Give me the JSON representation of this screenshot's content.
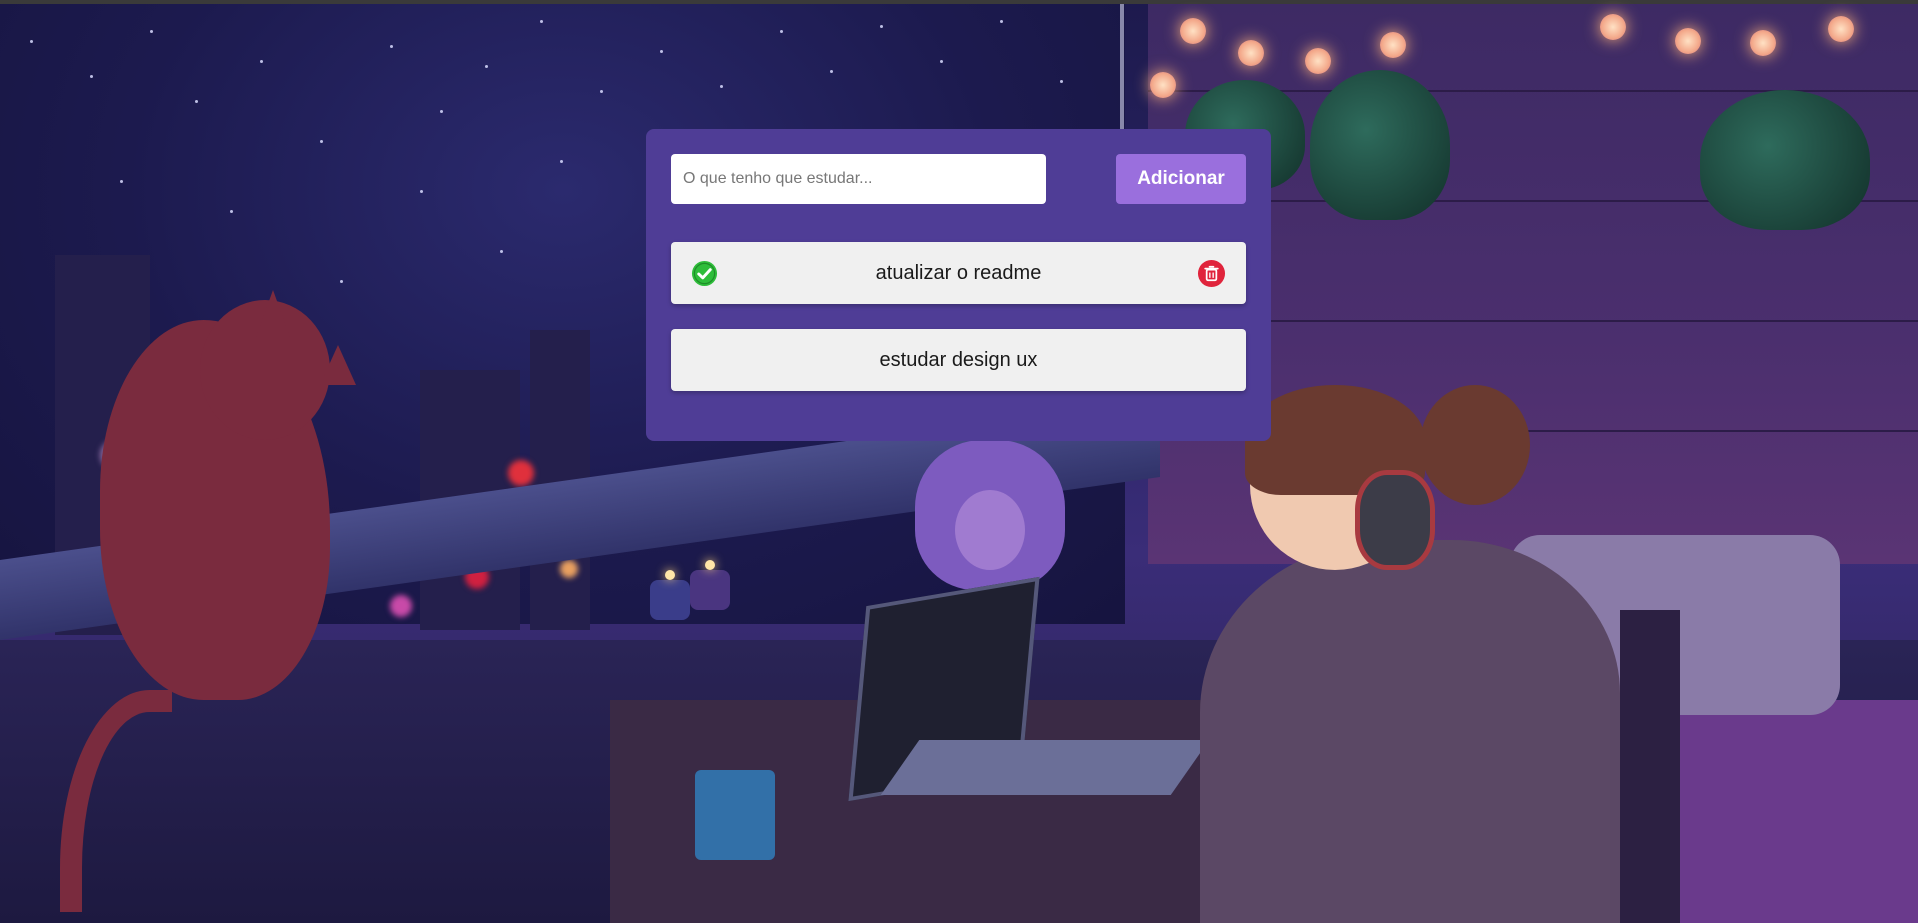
{
  "todo": {
    "input": {
      "placeholder": "O que tenho que estudar...",
      "value": ""
    },
    "add_button_label": "Adicionar",
    "tasks": [
      {
        "label": "atualizar o readme",
        "completed": true,
        "icons": [
          "check-circle-icon",
          "trash-icon"
        ]
      },
      {
        "label": "estudar design ux",
        "completed": false,
        "icons": []
      }
    ]
  },
  "colors": {
    "panel": "#4f3d96",
    "add_button": "#9a6fdd",
    "task_background": "#f0f0f0",
    "check": "#2ebd3a",
    "delete": "#e0243c"
  }
}
